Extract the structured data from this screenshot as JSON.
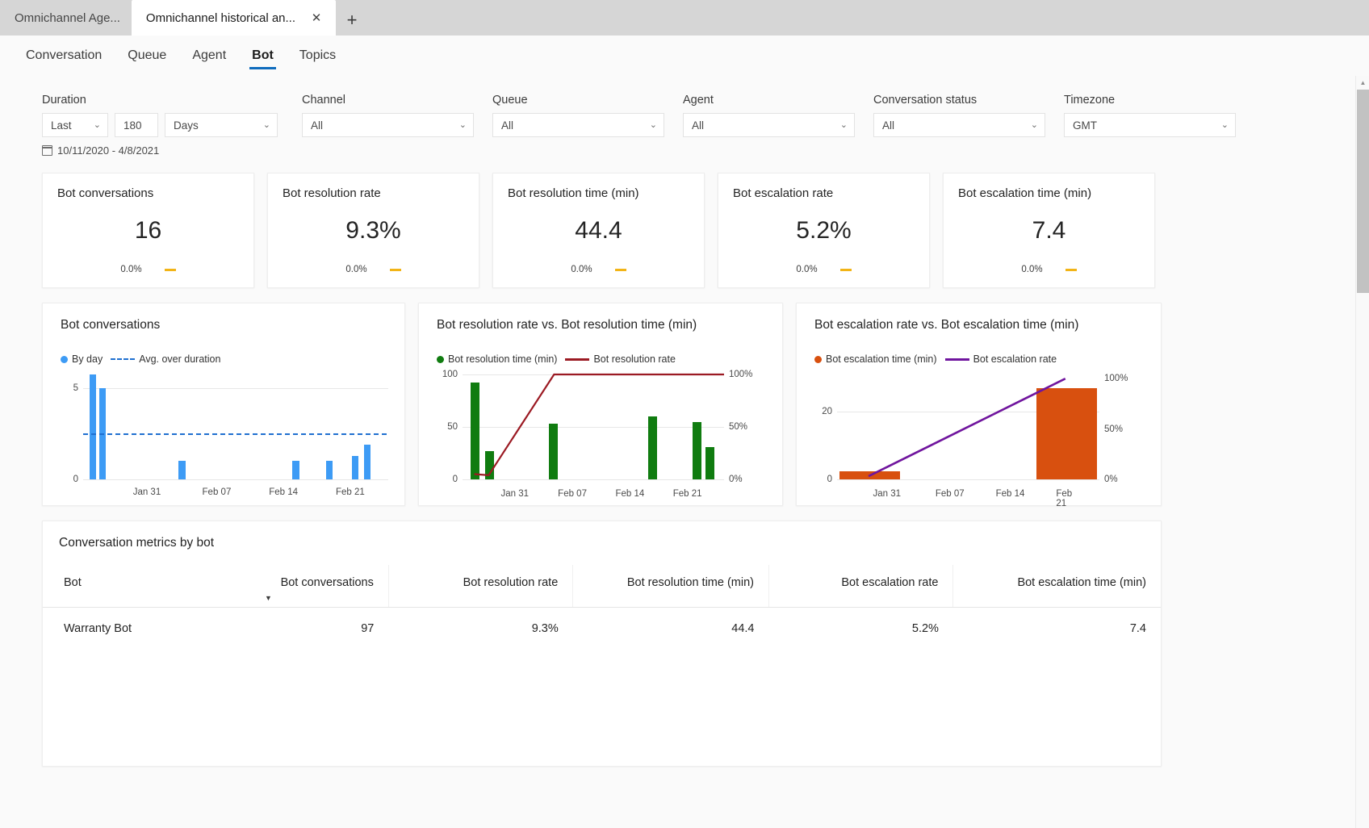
{
  "browser": {
    "tabs": [
      {
        "title": "Omnichannel Age...",
        "active": false
      },
      {
        "title": "Omnichannel historical an...",
        "active": true
      }
    ],
    "close_glyph": "✕",
    "newtab_glyph": "+"
  },
  "appnav": {
    "tabs": [
      {
        "label": "Conversation",
        "selected": false
      },
      {
        "label": "Queue",
        "selected": false
      },
      {
        "label": "Agent",
        "selected": false
      },
      {
        "label": "Bot",
        "selected": true
      },
      {
        "label": "Topics",
        "selected": false
      }
    ]
  },
  "filters": {
    "duration": {
      "label": "Duration",
      "mode_value": "Last",
      "count_value": "180",
      "unit_value": "Days"
    },
    "channel": {
      "label": "Channel",
      "value": "All"
    },
    "queue": {
      "label": "Queue",
      "value": "All"
    },
    "agent": {
      "label": "Agent",
      "value": "All"
    },
    "conversation_status": {
      "label": "Conversation status",
      "value": "All"
    },
    "timezone": {
      "label": "Timezone",
      "value": "GMT"
    },
    "date_range": "10/11/2020 - 4/8/2021",
    "chevron": "⌄"
  },
  "kpis": [
    {
      "title": "Bot conversations",
      "value": "16",
      "delta": "0.0%"
    },
    {
      "title": "Bot resolution rate",
      "value": "9.3%",
      "delta": "0.0%"
    },
    {
      "title": "Bot resolution time (min)",
      "value": "44.4",
      "delta": "0.0%"
    },
    {
      "title": "Bot escalation rate",
      "value": "5.2%",
      "delta": "0.0%"
    },
    {
      "title": "Bot escalation time (min)",
      "value": "7.4",
      "delta": "0.0%"
    }
  ],
  "colors": {
    "accent_blue": "#0f6cbd",
    "bar_blue": "#3d9bf5",
    "avg_line_blue": "#1f6fd0",
    "bar_green": "#107c10",
    "line_dark_red": "#9b1a23",
    "bar_orange": "#d8500f",
    "line_purple": "#70159e",
    "trend_amber": "#f2b417"
  },
  "chart_data": [
    {
      "type": "bar",
      "title": "Bot conversations",
      "legend": [
        {
          "label": "By day",
          "marker": "dot",
          "color": "#3d9bf5"
        },
        {
          "label": "Avg. over duration",
          "marker": "dashed-line",
          "color": "#1f6fd0"
        }
      ],
      "xlabel": "",
      "ylabel": "",
      "ylim": [
        0,
        6
      ],
      "yticks": [
        "0",
        "5"
      ],
      "xticks": [
        "Jan 31",
        "Feb 07",
        "Feb 14",
        "Feb 21"
      ],
      "grid": true,
      "average_line": 2,
      "categories": [
        "d1",
        "d2",
        "d3",
        "d4",
        "d5",
        "d6",
        "d7",
        "d8",
        "d9",
        "d10",
        "d11",
        "d12",
        "d13"
      ],
      "values": [
        6,
        5,
        0,
        0,
        0,
        1,
        0,
        0,
        0,
        1,
        1,
        1,
        2
      ]
    },
    {
      "type": "bar+line",
      "title": "Bot resolution rate vs. Bot resolution time (min)",
      "legend": [
        {
          "label": "Bot resolution time (min)",
          "marker": "dot",
          "color": "#107c10"
        },
        {
          "label": "Bot resolution rate",
          "marker": "solid-line",
          "color": "#9b1a23"
        }
      ],
      "ylim": [
        0,
        100
      ],
      "yticks": [
        "0",
        "50",
        "100"
      ],
      "y2ticks": [
        "0%",
        "50%",
        "100%"
      ],
      "y2lim": [
        0,
        100
      ],
      "xticks": [
        "Jan 31",
        "Feb 07",
        "Feb 14",
        "Feb 21"
      ],
      "grid": true,
      "series": [
        {
          "name": "Bot resolution time (min)",
          "type": "bar",
          "values": [
            92,
            27,
            0,
            0,
            53,
            0,
            0,
            0,
            60,
            0,
            55,
            31
          ]
        },
        {
          "name": "Bot resolution rate",
          "type": "line",
          "values": [
            5,
            4,
            100,
            100,
            100,
            100,
            100,
            100,
            100,
            100,
            100,
            100
          ]
        }
      ]
    },
    {
      "type": "bar+line",
      "title": "Bot escalation rate vs. Bot escalation time (min)",
      "legend": [
        {
          "label": "Bot escalation time (min)",
          "marker": "dot",
          "color": "#d8500f"
        },
        {
          "label": "Bot escalation rate",
          "marker": "solid-line",
          "color": "#70159e"
        }
      ],
      "ylim": [
        0,
        30
      ],
      "yticks": [
        "0",
        "20"
      ],
      "y2ticks": [
        "0%",
        "50%",
        "100%"
      ],
      "y2lim": [
        0,
        100
      ],
      "xticks": [
        "Jan 31",
        "Feb 07",
        "Feb 14",
        "Feb 21"
      ],
      "grid": true,
      "series": [
        {
          "name": "Bot escalation time (min)",
          "type": "bar",
          "values": [
            2.2,
            0,
            0,
            27
          ]
        },
        {
          "name": "Bot escalation rate",
          "type": "line",
          "values": [
            0,
            100
          ]
        }
      ]
    }
  ],
  "table": {
    "title": "Conversation metrics by bot",
    "sort_column": "Bot conversations",
    "sort_caret": "▼",
    "columns": [
      {
        "label": "Bot",
        "align": "left"
      },
      {
        "label": "Bot conversations",
        "align": "right"
      },
      {
        "label": "Bot resolution rate",
        "align": "right"
      },
      {
        "label": "Bot resolution time (min)",
        "align": "right"
      },
      {
        "label": "Bot escalation rate",
        "align": "right"
      },
      {
        "label": "Bot escalation time (min)",
        "align": "right"
      }
    ],
    "rows": [
      {
        "bot": "Warranty Bot",
        "bot_conversations": "97",
        "bot_resolution_rate": "9.3%",
        "bot_resolution_time": "44.4",
        "bot_escalation_rate": "5.2%",
        "bot_escalation_time": "7.4"
      }
    ]
  },
  "scrollbar": {
    "up_arrow": "▲"
  }
}
